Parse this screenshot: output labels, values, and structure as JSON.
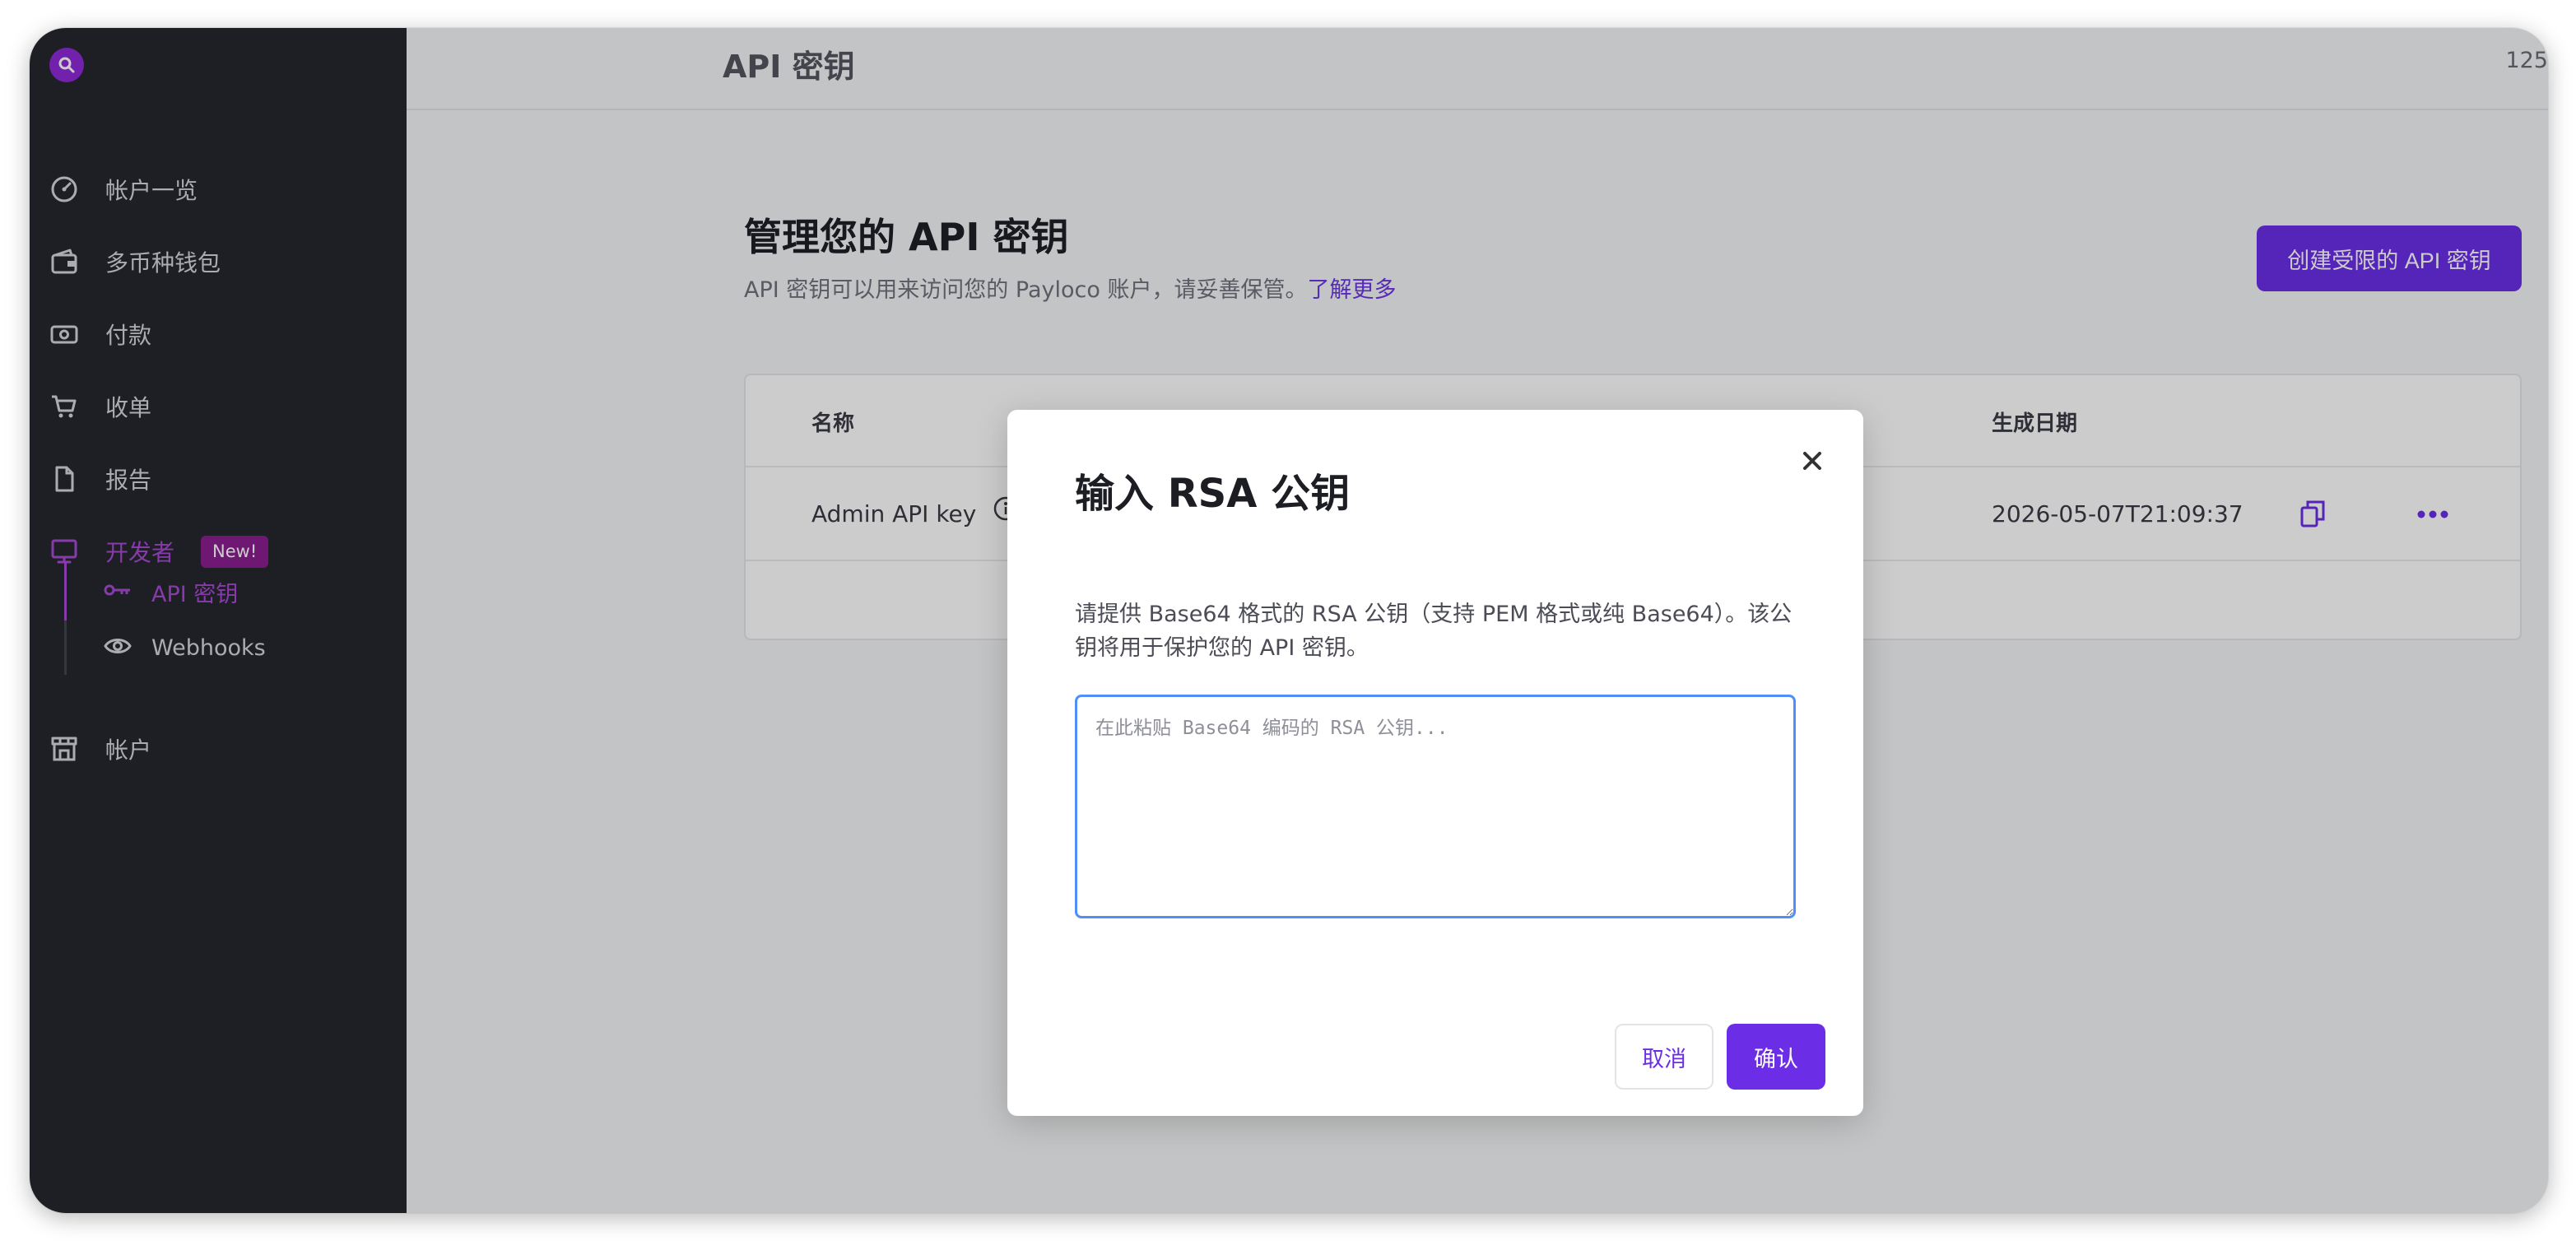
{
  "sidebar": {
    "items": [
      {
        "label": "帐户一览",
        "icon": "dashboard-icon"
      },
      {
        "label": "多币种钱包",
        "icon": "wallet-icon"
      },
      {
        "label": "付款",
        "icon": "banknote-icon"
      },
      {
        "label": "收单",
        "icon": "cart-icon"
      },
      {
        "label": "报告",
        "icon": "document-icon"
      },
      {
        "label": "开发者",
        "icon": "monitor-icon",
        "badge": "New!",
        "active": true
      },
      {
        "label": "帐户",
        "icon": "store-icon"
      }
    ],
    "sub_items": [
      {
        "label": "API 密钥",
        "icon": "key-icon",
        "active": true
      },
      {
        "label": "Webhooks",
        "icon": "eye-icon"
      }
    ]
  },
  "topbar": {
    "title": "API 密钥",
    "right_text": "125"
  },
  "main": {
    "title": "管理您的 API 密钥",
    "subtitle": "API 密钥可以用来访问您的 Payloco 账户，请妥善保管。",
    "learn_more": "了解更多",
    "create_button": "创建受限的 API 密钥"
  },
  "table": {
    "headers": {
      "name": "名称",
      "created": "生成日期"
    },
    "rows": [
      {
        "name": "Admin API key",
        "created": "2026-05-07T21:09:37"
      }
    ]
  },
  "modal": {
    "title": "输入 RSA 公钥",
    "description": "请提供 Base64 格式的 RSA 公钥（支持 PEM 格式或纯 Base64）。该公钥将用于保护您的 API 密钥。",
    "placeholder": "在此粘贴 Base64 编码的 RSA 公钥...",
    "cancel": "取消",
    "confirm": "确认"
  },
  "colors": {
    "accent": "#6b2ee6",
    "sidebar_bg": "#26272e",
    "active_nav": "#a94ad6",
    "badge_bg": "#8a1f91"
  }
}
